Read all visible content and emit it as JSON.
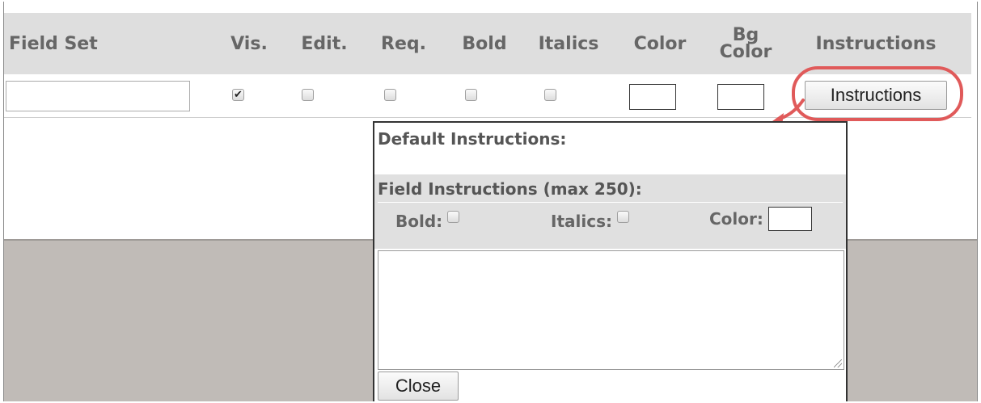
{
  "header": {
    "field_set": "Field Set",
    "vis": "Vis.",
    "edit": "Edit.",
    "req": "Req.",
    "bold": "Bold",
    "italics": "Italics",
    "color": "Color",
    "bg_color_line1": "Bg",
    "bg_color_line2": "Color",
    "instructions": "Instructions"
  },
  "row": {
    "field_set_value": "",
    "vis_checked": true,
    "edit_checked": false,
    "req_checked": false,
    "bold_checked": false,
    "italics_checked": false,
    "instructions_button": "Instructions"
  },
  "popup": {
    "default_instructions_label": "Default Instructions:",
    "field_instructions_label": "Field Instructions (max 250):",
    "bold_label": "Bold:",
    "italics_label": "Italics:",
    "color_label": "Color:",
    "textarea_value": "",
    "close_button": "Close"
  },
  "icons": {
    "check": "✔",
    "annotation_arrow": "red-arrow-icon"
  },
  "colors": {
    "header_bg": "#dedede",
    "annotation": "#e05a5a",
    "band": "#c0bbb7"
  }
}
